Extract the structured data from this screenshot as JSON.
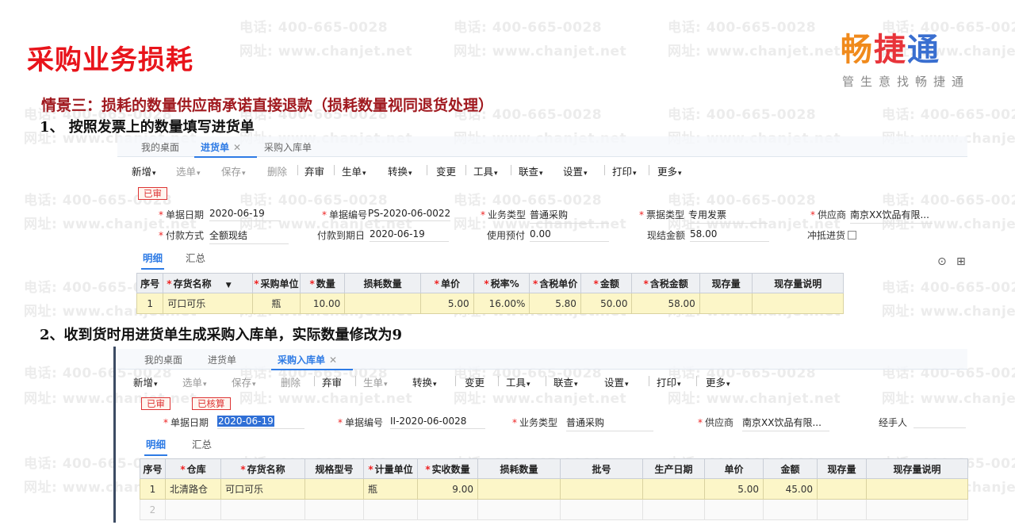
{
  "watermark": {
    "phone": "电话: 400-665-0028",
    "site": "网址: www.chanjet.net"
  },
  "title": "采购业务损耗",
  "logo": {
    "brand": [
      "畅",
      "捷",
      "通"
    ],
    "slogan": "管生意找畅捷通"
  },
  "scenario": "情景三：损耗的数量供应商承诺直接退款（损耗数量视同退货处理）",
  "step1": "1、 按照发票上的数量填写进货单",
  "step2": "2、收到货时用进货单生成采购入库单，实际数量修改为9",
  "panel1": {
    "tabs": [
      {
        "label": "我的桌面",
        "active": false
      },
      {
        "label": "进货单",
        "active": true,
        "closable": true
      },
      {
        "label": "采购入库单",
        "active": false
      }
    ],
    "toolbar": [
      {
        "label": "新增",
        "dropdown": true,
        "enabled": true
      },
      {
        "label": "选单",
        "dropdown": true,
        "enabled": false
      },
      {
        "label": "保存",
        "dropdown": true,
        "enabled": false
      },
      {
        "label": "删除",
        "dropdown": false,
        "enabled": false
      },
      {
        "label": "弃审",
        "dropdown": false,
        "enabled": true
      },
      {
        "label": "生单",
        "dropdown": true,
        "enabled": true
      },
      {
        "label": "转换",
        "dropdown": true,
        "enabled": true
      },
      {
        "label": "变更",
        "dropdown": false,
        "enabled": true
      },
      {
        "label": "工具",
        "dropdown": true,
        "enabled": true
      },
      {
        "label": "联查",
        "dropdown": true,
        "enabled": true
      },
      {
        "label": "设置",
        "dropdown": true,
        "enabled": true
      },
      {
        "label": "打印",
        "dropdown": true,
        "enabled": true
      },
      {
        "label": "更多",
        "dropdown": true,
        "enabled": true
      }
    ],
    "badges": [
      "已审"
    ],
    "fields": {
      "date_label": "单据日期",
      "date": "2020-06-19",
      "code_label": "单据编号",
      "code": "PS-2020-06-0022",
      "biz_label": "业务类型",
      "biz": "普通采购",
      "invoice_label": "票据类型",
      "invoice": "专用发票",
      "supplier_label": "供应商",
      "supplier": "南京XX饮品有限...",
      "pay_label": "付款方式",
      "pay": "全额现结",
      "due_label": "付款到期日",
      "due": "2020-06-19",
      "prepay_label": "使用预付",
      "prepay": "0.00",
      "cash_label": "现结金额",
      "cash": "58.00",
      "offset_label": "冲抵进货"
    },
    "subtabs": [
      "明细",
      "汇总"
    ],
    "columns": [
      "序号",
      "存货名称",
      "采购单位",
      "数量",
      "损耗数量",
      "单价",
      "税率%",
      "含税单价",
      "金额",
      "含税金额",
      "现存量",
      "现存量说明"
    ],
    "rows": [
      {
        "no": "1",
        "name": "可口可乐",
        "unit": "瓶",
        "qty": "10.00",
        "loss": "",
        "price": "5.00",
        "tax": "16.00%",
        "tax_price": "5.80",
        "amount": "50.00",
        "tax_amount": "58.00",
        "stock": "",
        "stock_note": ""
      }
    ]
  },
  "panel2": {
    "tabs": [
      {
        "label": "我的桌面",
        "active": false
      },
      {
        "label": "进货单",
        "active": false
      },
      {
        "label": "采购入库单",
        "active": true,
        "closable": true
      }
    ],
    "toolbar": [
      {
        "label": "新增",
        "dropdown": true,
        "enabled": true
      },
      {
        "label": "选单",
        "dropdown": true,
        "enabled": false
      },
      {
        "label": "保存",
        "dropdown": true,
        "enabled": false
      },
      {
        "label": "删除",
        "dropdown": false,
        "enabled": false
      },
      {
        "label": "弃审",
        "dropdown": false,
        "enabled": true
      },
      {
        "label": "生单",
        "dropdown": true,
        "enabled": false
      },
      {
        "label": "转换",
        "dropdown": true,
        "enabled": true
      },
      {
        "label": "变更",
        "dropdown": false,
        "enabled": true
      },
      {
        "label": "工具",
        "dropdown": true,
        "enabled": true
      },
      {
        "label": "联查",
        "dropdown": true,
        "enabled": true
      },
      {
        "label": "设置",
        "dropdown": true,
        "enabled": true
      },
      {
        "label": "打印",
        "dropdown": true,
        "enabled": true
      },
      {
        "label": "更多",
        "dropdown": true,
        "enabled": true
      }
    ],
    "badges": [
      "已审",
      "已核算"
    ],
    "fields": {
      "date_label": "单据日期",
      "date": "2020-06-19",
      "code_label": "单据编号",
      "code": "II-2020-06-0028",
      "biz_label": "业务类型",
      "biz": "普通采购",
      "supplier_label": "供应商",
      "supplier": "南京XX饮品有限...",
      "handler_label": "经手人"
    },
    "subtabs": [
      "明细",
      "汇总"
    ],
    "columns": [
      "序号",
      "仓库",
      "存货名称",
      "规格型号",
      "计量单位",
      "实收数量",
      "损耗数量",
      "批号",
      "生产日期",
      "单价",
      "金额",
      "现存量",
      "现存量说明"
    ],
    "rows": [
      {
        "no": "1",
        "wh": "北清路仓",
        "name": "可口可乐",
        "spec": "",
        "unit": "瓶",
        "qty": "9.00",
        "loss": "",
        "batch": "",
        "mfg": "",
        "price": "5.00",
        "amount": "45.00",
        "stock": "",
        "stock_note": ""
      }
    ],
    "empty_row_no": "2"
  },
  "colors": {
    "title": "#e8141b",
    "scenario": "#a0191f",
    "accent": "#2e7be5",
    "row_bg": "#fcf6c8",
    "badge": "#d33"
  }
}
